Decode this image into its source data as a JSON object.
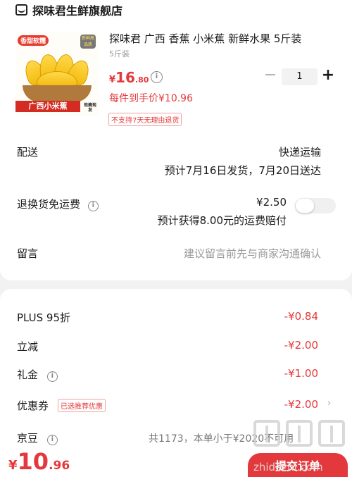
{
  "shop": {
    "name": "探味君生鲜旗舰店",
    "icon": "store-icon"
  },
  "product": {
    "title": "探味君 广西 香蕉 小米蕉 新鲜水果 5斤装",
    "spec": "5斤装",
    "price_symbol": "¥",
    "price_int": "16",
    "price_dec": ".80",
    "hand_price": "每件到手价¥10.96",
    "no_return": "不支持7天无理由退货",
    "quantity": "1",
    "image": {
      "tag_top_left": "香甜软糯",
      "tag_top_right": "新鲜高品质",
      "band_text": "广西小米蕉",
      "band_side": "现摘现发"
    }
  },
  "delivery": {
    "label": "配送",
    "method": "快递运输",
    "schedule": "预计7月16日发货，7月20日送达"
  },
  "return_shipping": {
    "label": "退换货免运费",
    "price": "¥2.50",
    "desc": "预计获得8.00元的运费赔付",
    "enabled": false
  },
  "remark": {
    "label": "留言",
    "placeholder": "建议留言前先与商家沟通确认"
  },
  "discounts": [
    {
      "label": "PLUS 95折",
      "value": "-¥0.84"
    },
    {
      "label": "立减",
      "value": "-¥2.00"
    },
    {
      "label": "礼金",
      "value": "-¥1.00"
    },
    {
      "label": "优惠券",
      "tag": "已选推荐优惠",
      "value": "-¥2.00"
    }
  ],
  "jd_beans": {
    "label": "京豆",
    "note": "共1173，本单小于¥2020不可用"
  },
  "footer": {
    "total_symbol": "¥",
    "total_int": "10",
    "total_dec": ".96",
    "submit_label": "提交订单"
  },
  "watermark": "值 什么值得买 zhidezhi.com",
  "colors": {
    "accent": "#e4393c",
    "background": "#f2f2f2"
  }
}
